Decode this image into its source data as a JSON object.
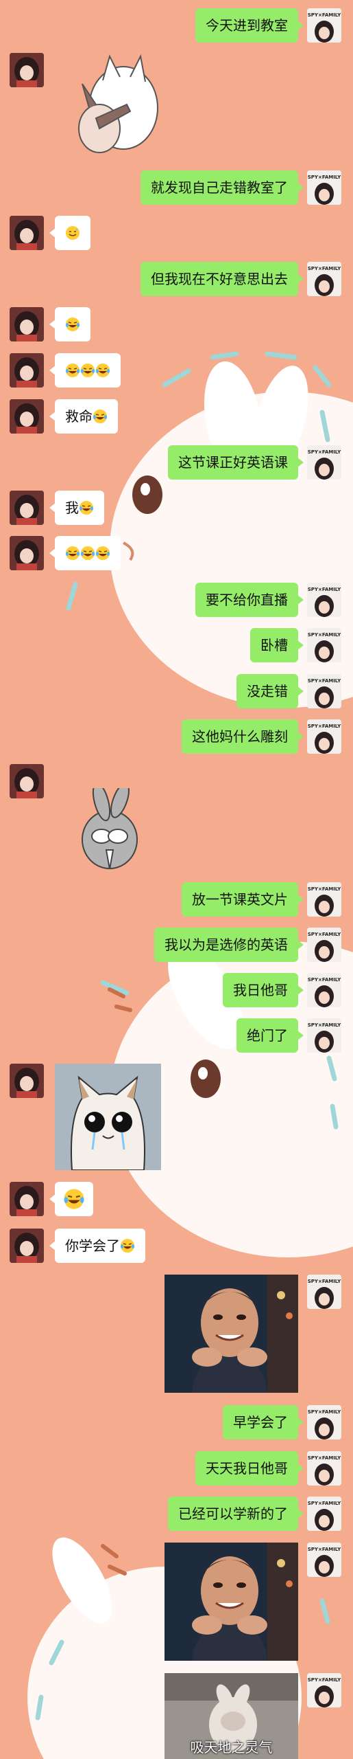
{
  "theme": {
    "background": "#f4ab8e",
    "sent_bubble": "#95ec69",
    "received_bubble": "#ffffff"
  },
  "avatars": {
    "me": "anime-girl-avatar-with-text",
    "me_text": "SPY×FAMILY",
    "friend": "anime-girl-avatar-dark-hair"
  },
  "messages": [
    {
      "side": "right",
      "kind": "text",
      "text": "今天进到教室"
    },
    {
      "side": "left",
      "kind": "sticker",
      "sticker": "white-cat-hugging-rabbit-sticker"
    },
    {
      "side": "right",
      "kind": "text",
      "text": "就发现自己走错教室了"
    },
    {
      "side": "left",
      "kind": "emoji",
      "emojis": [
        "sweat-smile-emoji"
      ]
    },
    {
      "side": "right",
      "kind": "text",
      "text": "但我现在不好意思出去"
    },
    {
      "side": "left",
      "kind": "emoji",
      "emojis": [
        "crying-laughing-emoji"
      ]
    },
    {
      "side": "left",
      "kind": "emoji",
      "emojis": [
        "crying-laughing-emoji",
        "crying-laughing-emoji",
        "crying-laughing-emoji"
      ]
    },
    {
      "side": "left",
      "kind": "text",
      "text": "救命",
      "emojis": [
        "crying-laughing-emoji"
      ]
    },
    {
      "side": "right",
      "kind": "text",
      "text": "这节课正好英语课"
    },
    {
      "side": "left",
      "kind": "text",
      "text": "我",
      "emojis": [
        "crying-laughing-emoji"
      ]
    },
    {
      "side": "left",
      "kind": "emoji",
      "emojis": [
        "crying-laughing-emoji",
        "crying-laughing-emoji",
        "crying-laughing-emoji"
      ]
    },
    {
      "side": "right",
      "kind": "text",
      "text": "要不给你直播"
    },
    {
      "side": "right",
      "kind": "text",
      "text": "卧槽"
    },
    {
      "side": "right",
      "kind": "text",
      "text": "没走错"
    },
    {
      "side": "right",
      "kind": "text",
      "text": "这他妈什么雕刻"
    },
    {
      "side": "left",
      "kind": "sticker",
      "sticker": "grey-rabbit-covering-face-sticker"
    },
    {
      "side": "right",
      "kind": "text",
      "text": "放一节课英文片"
    },
    {
      "side": "right",
      "kind": "text",
      "text": "我以为是选修的英语"
    },
    {
      "side": "right",
      "kind": "text",
      "text": "我日他哥"
    },
    {
      "side": "right",
      "kind": "text",
      "text": "绝门了"
    },
    {
      "side": "left",
      "kind": "image",
      "image": "crying-cat-meme"
    },
    {
      "side": "left",
      "kind": "emoji",
      "emojis": [
        "crying-laughing-emoji"
      ]
    },
    {
      "side": "left",
      "kind": "text",
      "text": "你学会了",
      "emojis": [
        "crying-laughing-emoji"
      ]
    },
    {
      "side": "right",
      "kind": "image",
      "image": "smiling-man-hands-on-chin-photo"
    },
    {
      "side": "right",
      "kind": "text",
      "text": "早学会了"
    },
    {
      "side": "right",
      "kind": "text",
      "text": "天天我日他哥"
    },
    {
      "side": "right",
      "kind": "text",
      "text": "已经可以学新的了"
    },
    {
      "side": "right",
      "kind": "image",
      "image": "smiling-man-hands-on-chin-photo"
    },
    {
      "side": "right",
      "kind": "image",
      "image": "dancing-goat-gif",
      "caption": "吸天地之灵气"
    }
  ]
}
